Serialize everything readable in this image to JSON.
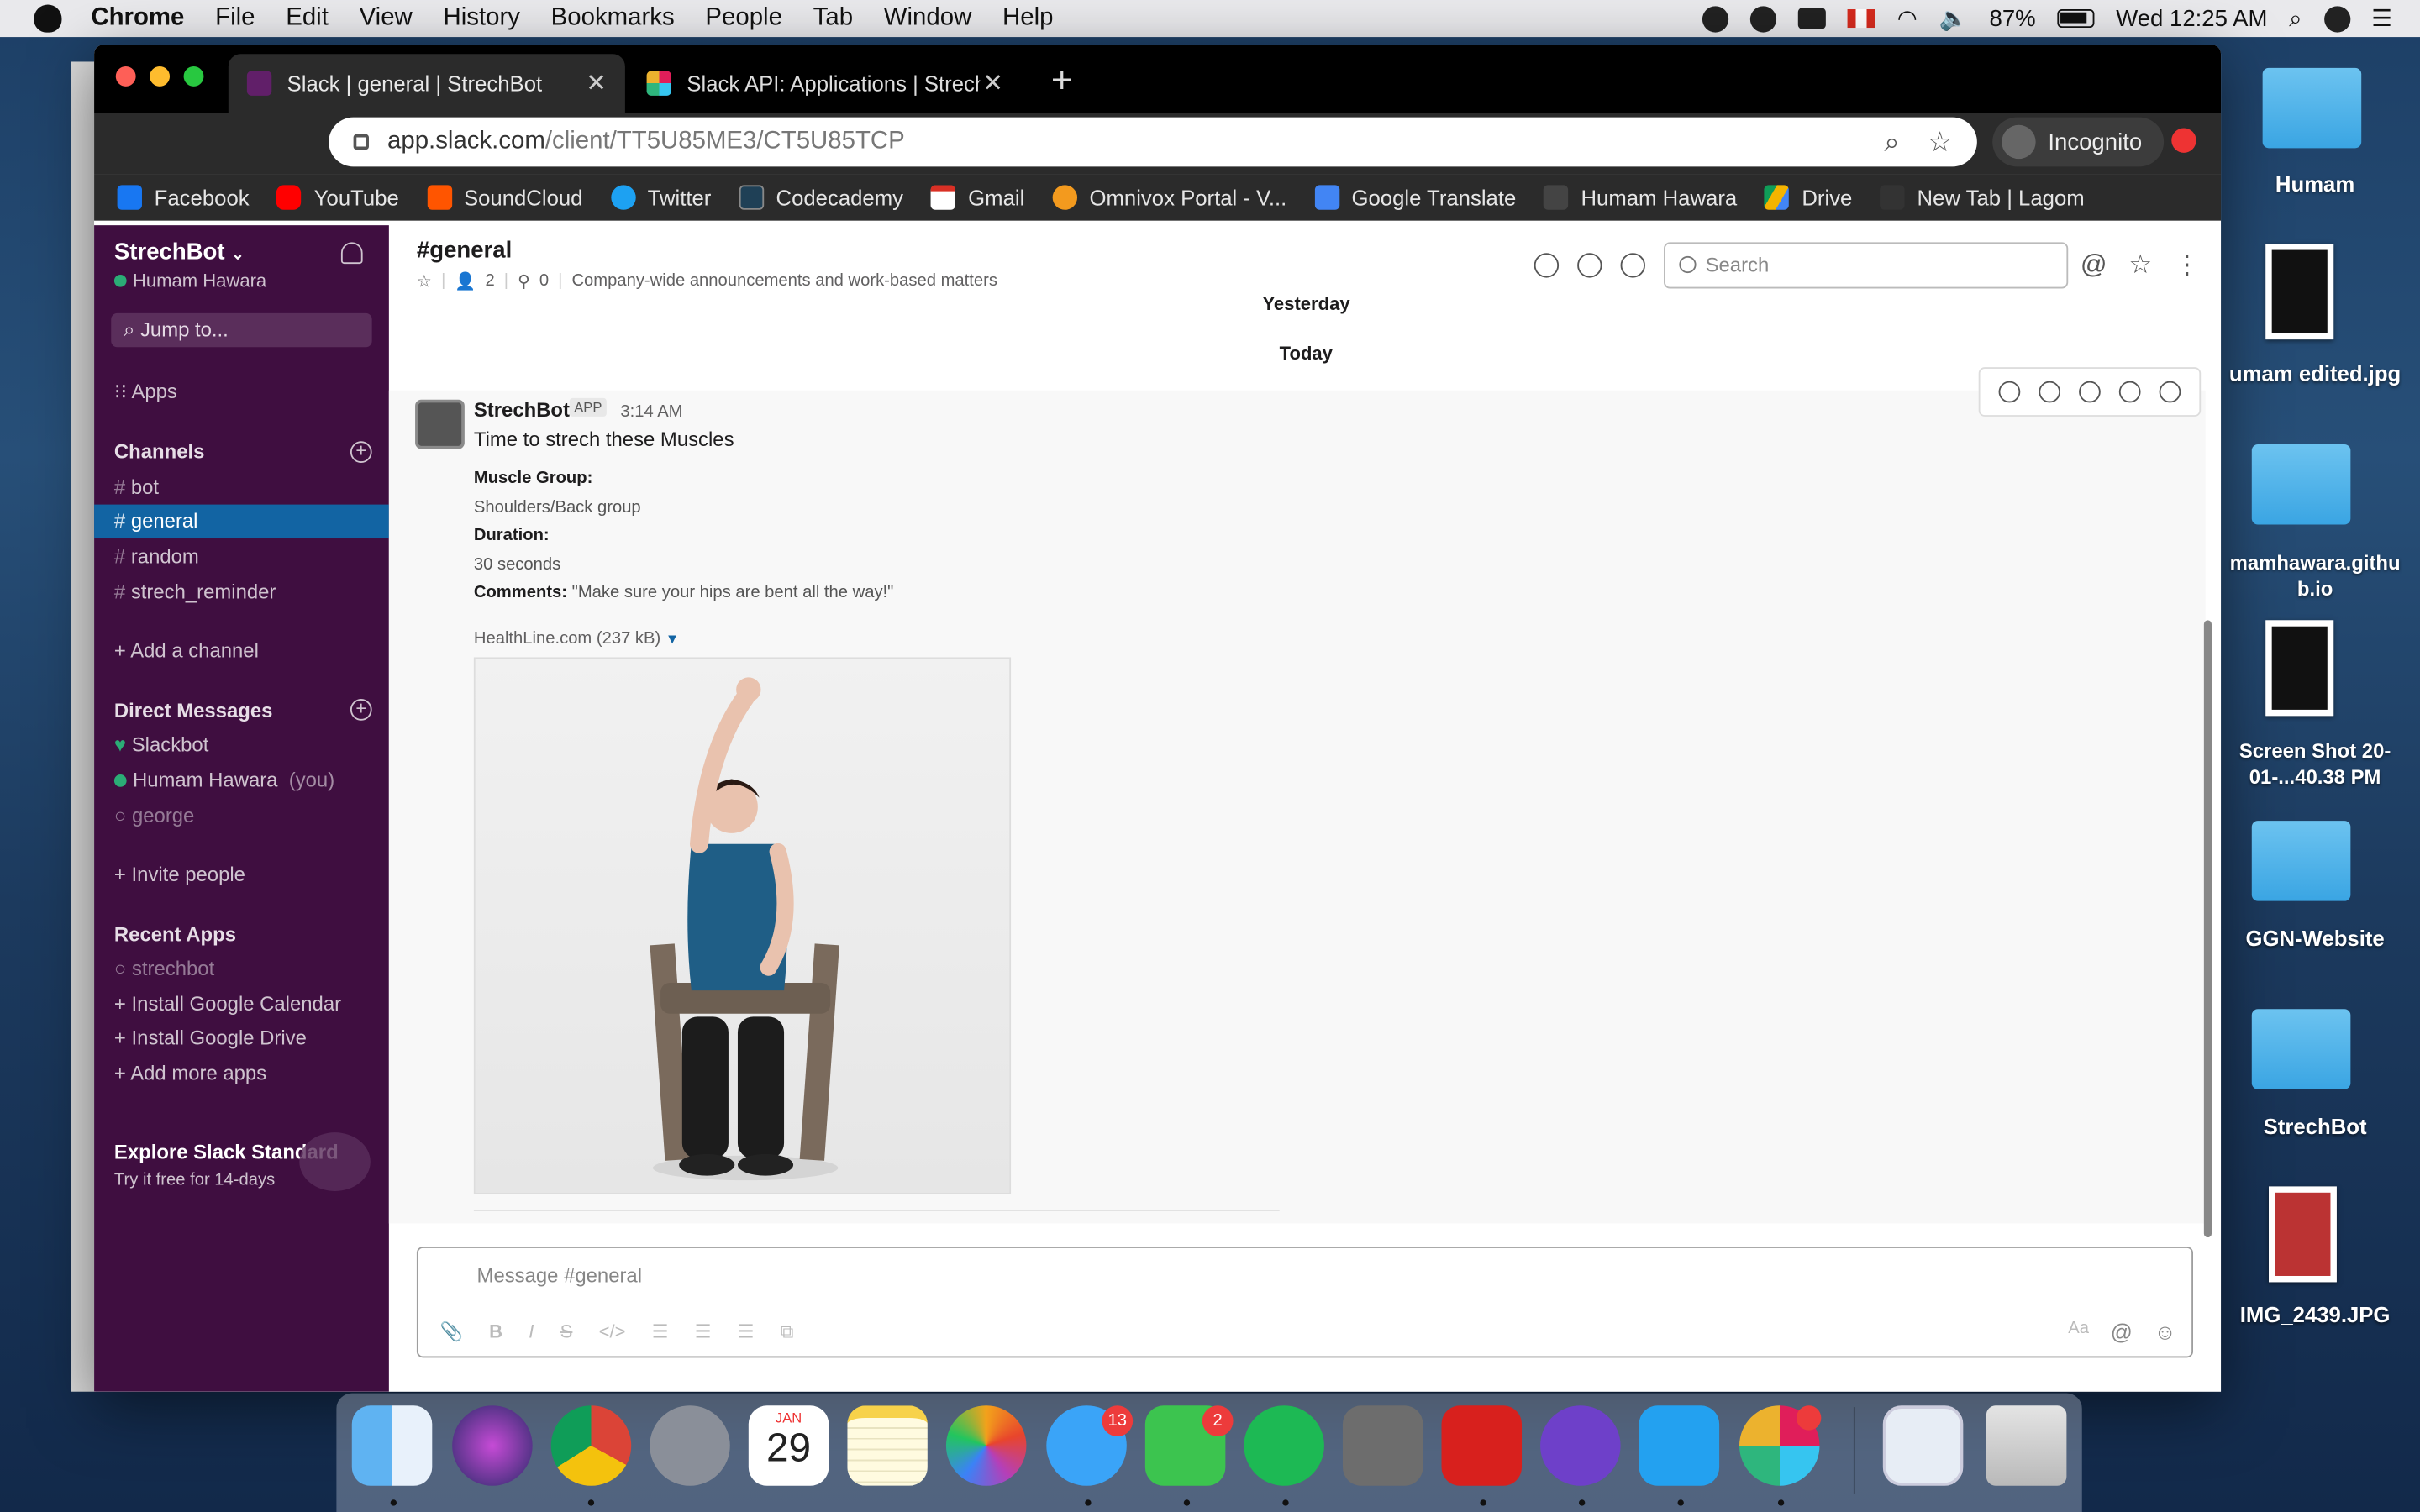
{
  "menubar": {
    "app": "Chrome",
    "items": [
      "File",
      "Edit",
      "View",
      "History",
      "Bookmarks",
      "People",
      "Tab",
      "Window",
      "Help"
    ],
    "battery": "87%",
    "clock": "Wed 12:25 AM"
  },
  "browser": {
    "tabs": [
      {
        "title": "Slack | general | StrechBot"
      },
      {
        "title": "Slack API: Applications | StrechB"
      }
    ],
    "url_host": "app.slack.com",
    "url_path": "/client/TT5U85ME3/CT5U85TCP",
    "incognito": "Incognito",
    "bookmarks": [
      "Facebook",
      "YouTube",
      "SoundCloud",
      "Twitter",
      "Codecademy",
      "Gmail",
      "Omnivox Portal - V...",
      "Google Translate",
      "Humam Hawara",
      "Drive",
      "New Tab | Lagom"
    ]
  },
  "sidebar": {
    "workspace": "StrechBot",
    "user": "Humam Hawara",
    "jump": "Jump to...",
    "apps": "Apps",
    "channels_header": "Channels",
    "channels": [
      "bot",
      "general",
      "random",
      "strech_reminder"
    ],
    "add_channel": "Add a channel",
    "dm_header": "Direct Messages",
    "dms": [
      "Slackbot",
      "Humam Hawara",
      "george"
    ],
    "you": "(you)",
    "invite": "Invite people",
    "recent_header": "Recent Apps",
    "recent": [
      "strechbot",
      "Install Google Calendar",
      "Install Google Drive",
      "Add more apps"
    ],
    "explore": "Explore Slack Standard",
    "trial": "Try it free for 14-days"
  },
  "channel": {
    "name": "#general",
    "members": "2",
    "pins": "0",
    "topic": "Company-wide announcements and work-based matters",
    "search_placeholder": "Search",
    "day1": "Yesterday",
    "day2": "Today"
  },
  "message": {
    "sender": "StrechBot",
    "badge": "APP",
    "time": "3:14 AM",
    "text": "Time to strech these Muscles",
    "muscle_label": "Muscle Group:",
    "muscle_value": "Shoulders/Back group",
    "duration_label": "Duration:",
    "duration_value": "30 seconds",
    "comments_label": "Comments:",
    "comments_value": "\"Make sure your hips are bent all the way!\"",
    "attachment": "HealthLine.com (237 kB)"
  },
  "composer": {
    "placeholder": "Message #general"
  },
  "desktop": [
    "Humam",
    "umam edited.jpg",
    "mamhawara.githu b.io",
    "Screen Shot 20-01-...40.38 PM",
    "GGN-Website",
    "StrechBot",
    "IMG_2439.JPG"
  ],
  "dock": {
    "calendar_month": "JAN",
    "calendar_day": "29",
    "messages_badge": "13",
    "facetime_badge": "2"
  }
}
